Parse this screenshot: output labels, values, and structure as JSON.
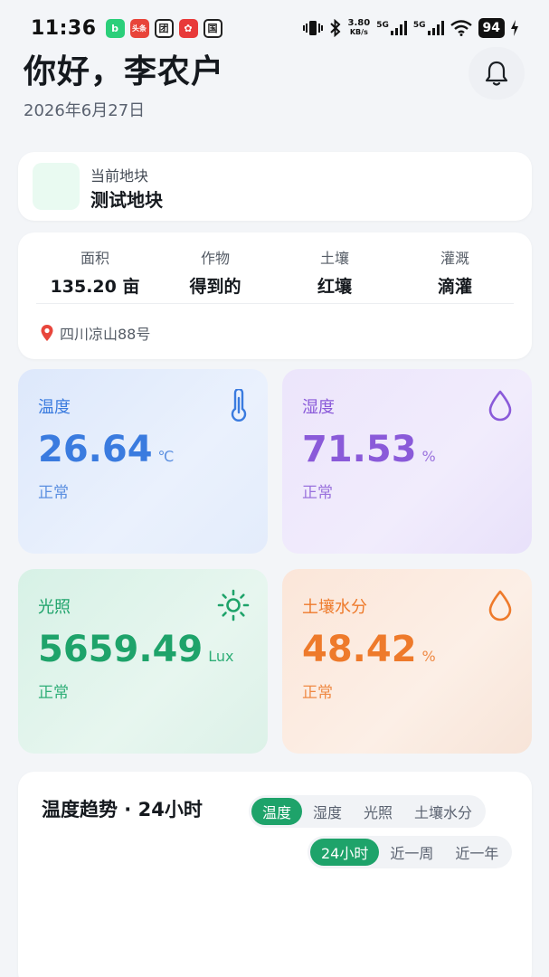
{
  "status_bar": {
    "time": "11:36",
    "apps": [
      {
        "icon": "douyin-app-icon",
        "glyph": "b",
        "color": "#2bcf7a"
      },
      {
        "icon": "toutiao-app-icon",
        "glyph": "头条",
        "color": "#e8443a"
      },
      {
        "icon": "meituan-app-icon",
        "glyph": "团",
        "color": "#222222"
      },
      {
        "icon": "flower-app-icon",
        "glyph": "✿",
        "color": "#e83a3a"
      },
      {
        "icon": "bank-app-icon",
        "glyph": "国",
        "color": "#222222"
      }
    ],
    "speed_top": "3.80",
    "speed_bottom": "KB/s",
    "network_1": "5G",
    "network_2": "5G",
    "battery": "94"
  },
  "header": {
    "greeting": "你好，李农户",
    "date": "2026年6月27日"
  },
  "plot": {
    "label": "当前地块",
    "name": "测试地块"
  },
  "info": {
    "area_label": "面积",
    "area_value": "135.20 亩",
    "crop_label": "作物",
    "crop_value": "得到的",
    "soil_label": "土壤",
    "soil_value": "红壤",
    "irrigation_label": "灌溉",
    "irrigation_value": "滴灌",
    "location": "四川凉山88号"
  },
  "metrics": {
    "temperature": {
      "label": "温度",
      "value": "26.64",
      "unit": "℃",
      "status": "正常",
      "color": "#3a7bdf"
    },
    "humidity": {
      "label": "湿度",
      "value": "71.53",
      "unit": "%",
      "status": "正常",
      "color": "#8a5ad9"
    },
    "light": {
      "label": "光照",
      "value": "5659.49",
      "unit": "Lux",
      "status": "正常",
      "color": "#1ea36a"
    },
    "soil_moisture": {
      "label": "土壤水分",
      "value": "48.42",
      "unit": "%",
      "status": "正常",
      "color": "#ee7a2b"
    }
  },
  "trend": {
    "title": "温度趋势 · 24小时",
    "metric_tabs": [
      "温度",
      "湿度",
      "光照",
      "土壤水分"
    ],
    "metric_selected": "温度",
    "range_tabs": [
      "24小时",
      "近一周",
      "近一年"
    ],
    "range_selected": "24小时",
    "accent": "#1ea36a"
  }
}
